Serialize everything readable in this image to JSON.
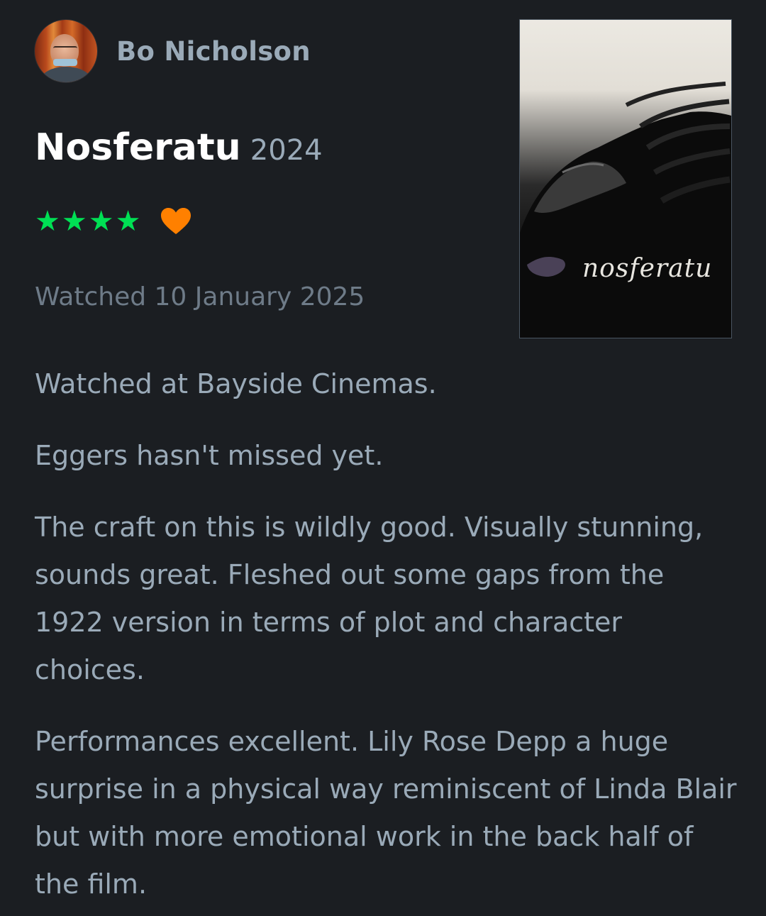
{
  "author": {
    "name": "Bo Nicholson"
  },
  "film": {
    "title": "Nosferatu",
    "year": "2024",
    "poster_logo": "nosferatu"
  },
  "rating": {
    "stars": "★★★★",
    "star_count": 4,
    "liked": true,
    "star_color": "#00e054",
    "heart_color": "#ff8000"
  },
  "watched": {
    "text": "Watched 10 January 2025"
  },
  "review": {
    "paragraphs": [
      "Watched at Bayside Cinemas.",
      "Eggers hasn't missed yet.",
      "The craft on this is wildly good. Visually stunning, sounds great. Fleshed out some gaps from the 1922 version in terms of plot and character choices.",
      "Performances excellent. Lily Rose Depp a huge surprise in a physical way reminiscent of Linda Blair but with more emotional work in the back half of the film."
    ]
  },
  "icons": {
    "heart": "heart-icon",
    "star": "star-icon"
  }
}
